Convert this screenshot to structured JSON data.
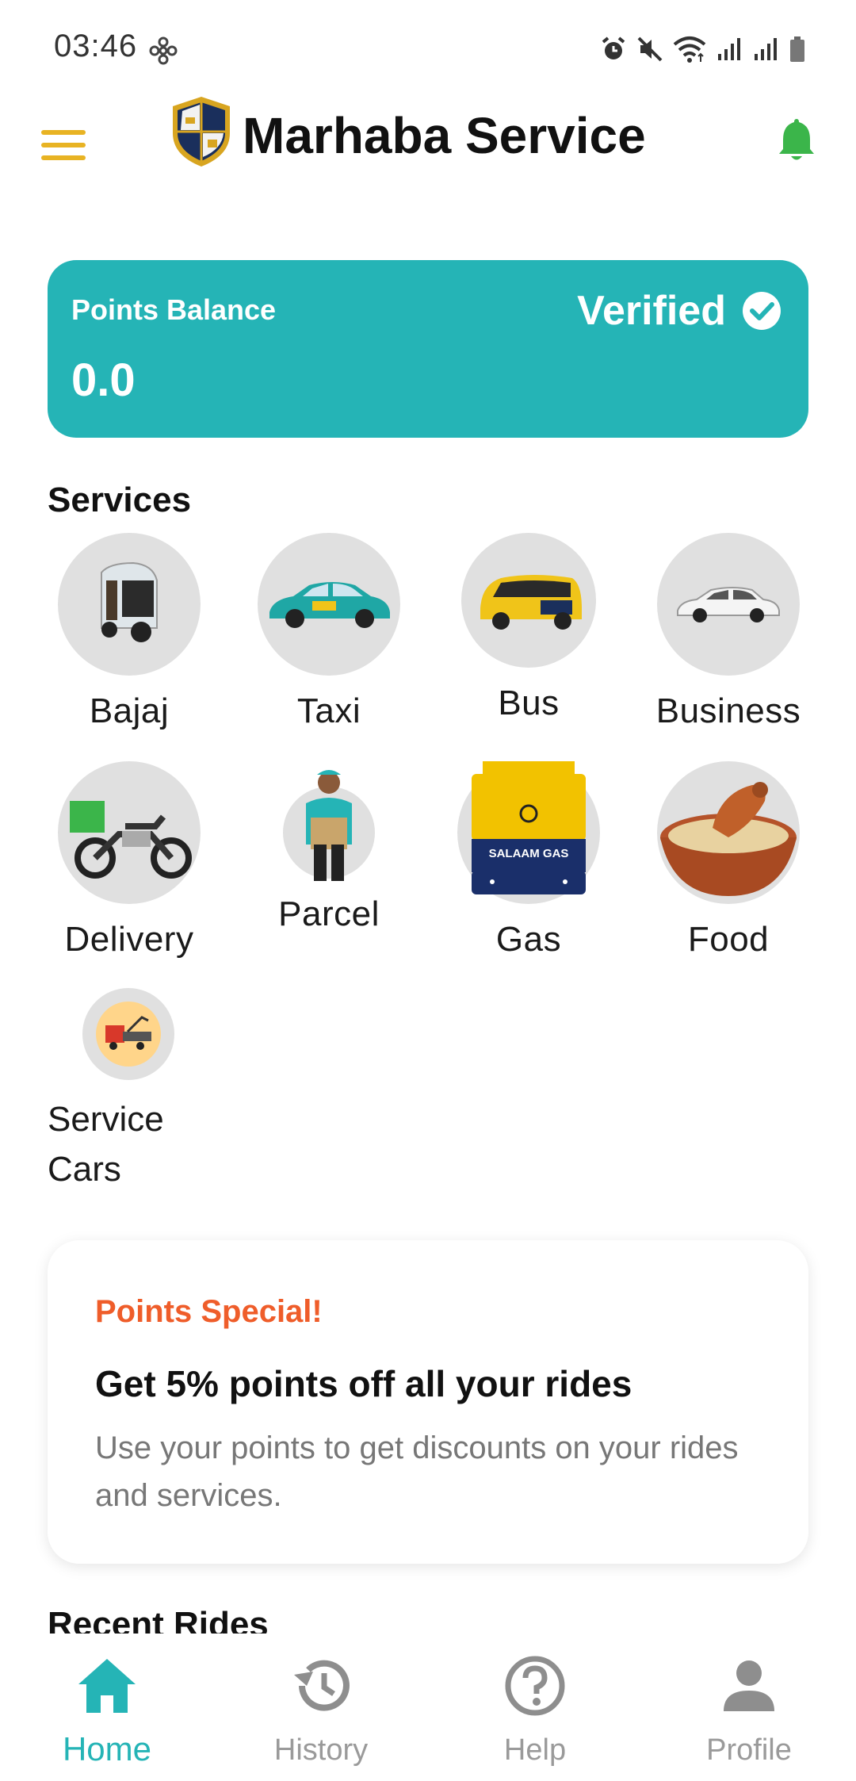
{
  "status_bar": {
    "time": "03:46",
    "icons": [
      "fan-icon",
      "alarm-icon",
      "mute-icon",
      "wifi-icon",
      "signal-icon",
      "signal-icon",
      "battery-icon"
    ]
  },
  "app_bar": {
    "title": "Marhaba Service",
    "menu_icon": "menu-icon",
    "notification_icon": "bell-icon"
  },
  "points_card": {
    "label": "Points Balance",
    "value": "0.0",
    "status": "Verified",
    "status_icon": "check-circle-icon"
  },
  "services": {
    "title": "Services",
    "items": [
      {
        "label": "Bajaj",
        "icon": "bajaj-image"
      },
      {
        "label": "Taxi",
        "icon": "taxi-image"
      },
      {
        "label": "Bus",
        "icon": "bus-image"
      },
      {
        "label": "Business",
        "icon": "business-car-image"
      },
      {
        "label": "Delivery",
        "icon": "motorbike-image"
      },
      {
        "label": "Parcel",
        "icon": "parcel-courier-image"
      },
      {
        "label": "Gas",
        "icon": "gas-cylinder-image",
        "badge_text": "SALAAM GAS"
      },
      {
        "label": "Food",
        "icon": "food-bowl-image"
      },
      {
        "label": "Service Cars",
        "icon": "tow-truck-image"
      }
    ]
  },
  "promo": {
    "kicker": "Points Special!",
    "title": "Get 5% points off all your rides",
    "body": "Use your points to get discounts on your rides and services."
  },
  "recent_rides": {
    "title": "Recent Rides"
  },
  "bottom_nav": {
    "items": [
      {
        "label": "Home",
        "icon": "home-icon",
        "active": true
      },
      {
        "label": "History",
        "icon": "history-icon",
        "active": false
      },
      {
        "label": "Help",
        "icon": "help-icon",
        "active": false
      },
      {
        "label": "Profile",
        "icon": "profile-icon",
        "active": false
      }
    ]
  },
  "colors": {
    "primary": "#25b4b6",
    "accent_yellow": "#e8b323",
    "promo_orange": "#ef5d2a",
    "bell_green": "#3bb54a",
    "inactive_gray": "#9a9a9a"
  }
}
